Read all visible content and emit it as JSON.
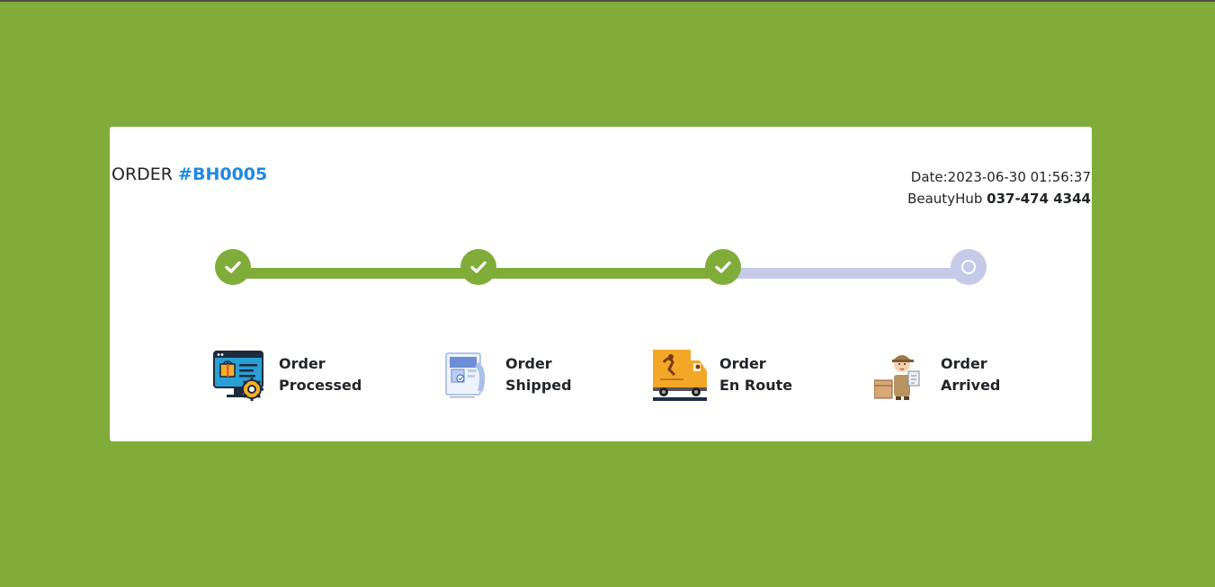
{
  "header": {
    "order_prefix": "ORDER",
    "order_id": "#BH0005",
    "date": "Date:2023-06-30 01:56:37",
    "store": "BeautyHub",
    "phone": "037-474 4344"
  },
  "progress": {
    "steps_completed": 3,
    "steps_total": 4
  },
  "steps": [
    {
      "status": "completed",
      "icon": "check-icon"
    },
    {
      "status": "completed",
      "icon": "check-icon"
    },
    {
      "status": "completed",
      "icon": "check-icon"
    },
    {
      "status": "pending",
      "icon": "ring-icon"
    }
  ],
  "stages": [
    {
      "line1": "Order",
      "line2": "Processed",
      "icon": "processing-illustration"
    },
    {
      "line1": "Order",
      "line2": "Shipped",
      "icon": "shipped-illustration"
    },
    {
      "line1": "Order",
      "line2": "En Route",
      "icon": "delivery-truck-illustration"
    },
    {
      "line1": "Order",
      "line2": "Arrived",
      "icon": "courier-arrived-illustration"
    }
  ],
  "colors": {
    "background": "#80ad3a",
    "accent": "#1e88e5",
    "completed": "#80ad3a",
    "pending": "#c5cae9"
  }
}
